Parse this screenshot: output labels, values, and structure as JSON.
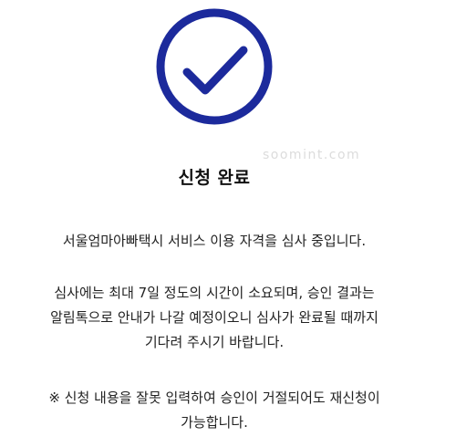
{
  "status": {
    "icon": "check-circle-icon",
    "accent_color": "#1c2a9c"
  },
  "watermark": "soomint.com",
  "title": "신청 완료",
  "messages": {
    "review": "서울엄마아빠택시 서비스 이용 자격을 심사 중입니다.",
    "duration": [
      "심사에는 최대 7일 정도의 시간이 소요되며, 승인 결과는",
      "알림톡으로 안내가 나갈 예정이오니 심사가 완료될 때까지",
      "기다려 주시기 바랍니다."
    ],
    "notice": [
      "※ 신청 내용을 잘못 입력하여 승인이 거절되어도 재신청이",
      "가능합니다."
    ]
  }
}
